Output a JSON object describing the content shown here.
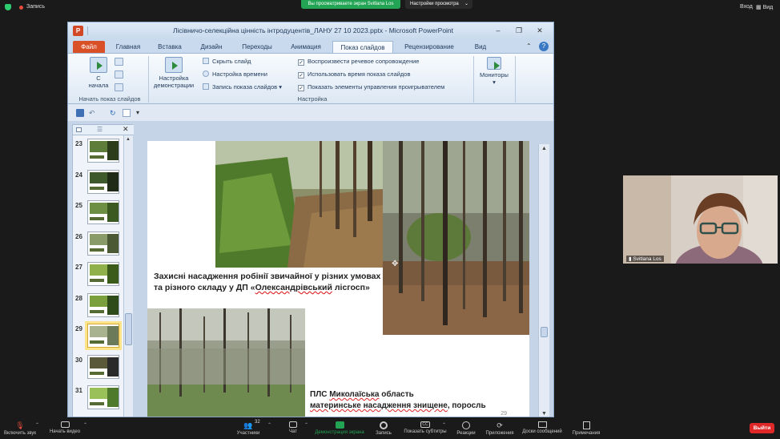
{
  "zoom_top": {
    "recording_label": "Запись",
    "viewing_banner": "Вы просматриваете экран Svitlana Los",
    "view_options": "Настройки просмотра",
    "login": "Вход",
    "view": "Вид"
  },
  "powerpoint": {
    "window_title": "Лісівничо-селекційна цінність інтродуцентів_ЛАНУ 27 10 2023.pptx  -  Microsoft PowerPoint",
    "tabs": [
      "Файл",
      "Главная",
      "Вставка",
      "Дизайн",
      "Переходы",
      "Анимация",
      "Показ слайдов",
      "Рецензирование",
      "Вид"
    ],
    "active_tab": "Показ слайдов",
    "ribbon": {
      "start_group_label": "Начать показ слайдов",
      "from_start_line1": "С",
      "from_start_line2": "начала",
      "setup_group_label": "Настройка",
      "setup_show_line1": "Настройка",
      "setup_show_line2": "демонстрации",
      "hide_slide": "Скрыть слайд",
      "rehearse_timings": "Настройка времени",
      "record_show": "Запись показа слайдов",
      "play_narrations": "Воспроизвести речевое сопровождение",
      "use_timings": "Использовать время показа слайдов",
      "show_media_controls": "Показать элементы управления проигрывателем",
      "monitors": "Мониторы"
    },
    "thumbnails": [
      {
        "num": "23",
        "selected": false
      },
      {
        "num": "24",
        "selected": false
      },
      {
        "num": "25",
        "selected": false
      },
      {
        "num": "26",
        "selected": false
      },
      {
        "num": "27",
        "selected": false
      },
      {
        "num": "28",
        "selected": false
      },
      {
        "num": "29",
        "selected": true
      },
      {
        "num": "30",
        "selected": false
      },
      {
        "num": "31",
        "selected": false
      }
    ],
    "slide": {
      "caption1_line1": "Захисні насадження робінії звичайної у різних умовах",
      "caption1_line2_pre": "та різного складу у ДП «",
      "caption1_line2_underlined": "Олександрівський",
      "caption1_line2_post": " лісгосп»",
      "caption2_line1_pre": "ПЛС ",
      "caption2_line1_underlined": "Миколаїська",
      "caption2_line1_post": " область",
      "caption2_line2_underlined": "материнське насадження знищене",
      "caption2_line2_post": ", поросль",
      "slide_number": "29"
    }
  },
  "participant_video": {
    "name": "Svitlana Los"
  },
  "zoom_bottom": {
    "unmute": "Включить звук",
    "start_video": "Начать видео",
    "participants": "Участники",
    "participants_count": "32",
    "chat": "Чат",
    "share_screen": "Демонстрация экрана",
    "record": "Запись",
    "captions": "Показать субтитры",
    "reactions": "Реакции",
    "apps": "Приложения",
    "whiteboards": "Доски сообщений",
    "notes": "Примечания",
    "leave": "Выйти"
  },
  "colors": {
    "zoom_green": "#23a455",
    "leave_red": "#e02828",
    "ppt_orange": "#d24726"
  }
}
